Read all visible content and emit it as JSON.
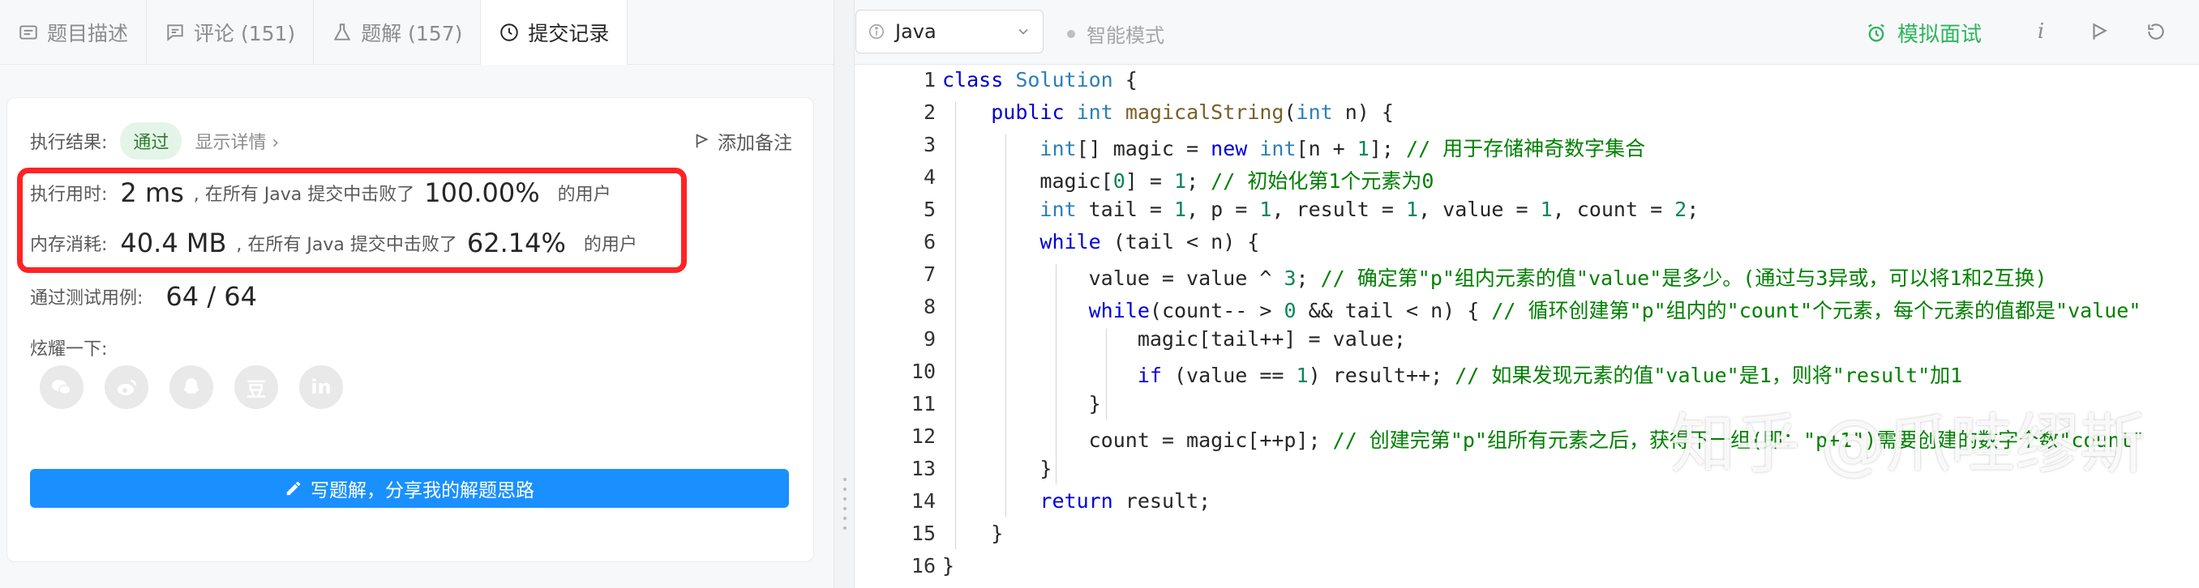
{
  "tabs": [
    {
      "label": "题目描述",
      "icon": "description-icon"
    },
    {
      "label": "评论 (151)",
      "icon": "comment-icon"
    },
    {
      "label": "题解 (157)",
      "icon": "flask-icon"
    },
    {
      "label": "提交记录",
      "icon": "clock-icon"
    }
  ],
  "result": {
    "label": "执行结果:",
    "status": "通过",
    "details": "显示详情 ›",
    "add_note": "添加备注",
    "runtime_label": "执行用时:",
    "runtime_value": "2 ms",
    "runtime_mid": ", 在所有 Java 提交中击败了",
    "runtime_pct": "100.00%",
    "runtime_suffix": "的用户",
    "memory_label": "内存消耗:",
    "memory_value": "40.4 MB",
    "memory_mid": ", 在所有 Java 提交中击败了",
    "memory_pct": "62.14%",
    "memory_suffix": "的用户",
    "tests_label": "通过测试用例:",
    "tests_value": "64 / 64",
    "share_label": "炫耀一下:",
    "write_solution": "写题解，分享我的解题思路"
  },
  "share_icons": [
    "wechat-icon",
    "weibo-icon",
    "qq-icon",
    "douban-icon",
    "linkedin-icon"
  ],
  "douban_glyph": "豆",
  "linkedin_glyph": "in",
  "editor": {
    "language": "Java",
    "smart_mode": "智能模式",
    "mock_interview": "模拟面试"
  },
  "code_lines": [
    "class Solution {",
    "    public int magicalString(int n) {",
    "        int[] magic = new int[n + 1]; // 用于存储神奇数字集合",
    "        magic[0] = 1; // 初始化第1个元素为0",
    "        int tail = 1, p = 1, result = 1, value = 1, count = 2;",
    "        while (tail < n) {",
    "            value = value ^ 3; // 确定第\"p\"组内元素的值\"value\"是多少。(通过与3异或，可以将1和2互换)",
    "            while(count-- > 0 && tail < n) { // 循环创建第\"p\"组内的\"count\"个元素，每个元素的值都是\"value\"",
    "                magic[tail++] = value;",
    "                if (value == 1) result++; // 如果发现元素的值\"value\"是1，则将\"result\"加1",
    "            }",
    "            count = magic[++p]; // 创建完第\"p\"组所有元素之后，获得下一组(即：\"p+1\")需要创建的数字个数\"count\"",
    "        }",
    "        return result;",
    "    }",
    "}"
  ],
  "watermark": "知乎 @爪哇缪斯",
  "colors": {
    "accent_blue": "#1a90ff",
    "pass_green": "#2e7d32",
    "highlight_red": "#ff2424",
    "mock_green": "#2db55d"
  }
}
